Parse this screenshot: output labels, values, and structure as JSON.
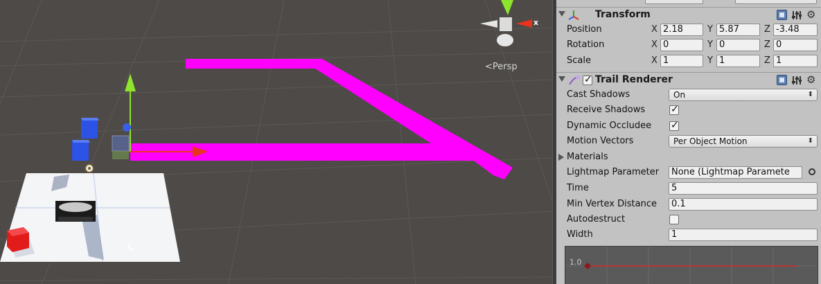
{
  "scene": {
    "persp_label": "Persp",
    "gizmo_axis_label": "x"
  },
  "transform": {
    "title": "Transform",
    "rows": [
      {
        "label": "Position",
        "x": "2.18",
        "y": "5.87",
        "z": "-3.48"
      },
      {
        "label": "Rotation",
        "x": "0",
        "y": "0",
        "z": "0"
      },
      {
        "label": "Scale",
        "x": "1",
        "y": "1",
        "z": "1"
      }
    ],
    "axis_x": "X",
    "axis_y": "Y",
    "axis_z": "Z"
  },
  "trail_renderer": {
    "title": "Trail Renderer",
    "enabled": true,
    "cast_shadows_label": "Cast Shadows",
    "cast_shadows_value": "On",
    "receive_shadows_label": "Receive Shadows",
    "receive_shadows_checked": true,
    "dynamic_occludee_label": "Dynamic Occludee",
    "dynamic_occludee_checked": true,
    "motion_vectors_label": "Motion Vectors",
    "motion_vectors_value": "Per Object Motion",
    "materials_label": "Materials",
    "lightmap_label": "Lightmap Parameter",
    "lightmap_value": "None (Lightmap Paramete",
    "time_label": "Time",
    "time_value": "5",
    "min_vertex_label": "Min Vertex Distance",
    "min_vertex_value": "0.1",
    "autodestruct_label": "Autodestruct",
    "autodestruct_checked": false,
    "width_label": "Width",
    "width_value": "1",
    "curve_y_label": "1.0"
  },
  "colors": {
    "trail": "#ff00ff",
    "inspector_bg": "#c2c2c2",
    "scene_bg": "#4d4a47",
    "axis_x": "#e8341c",
    "axis_y": "#8ee52d",
    "axis_z": "#3a5ee8"
  },
  "icons": {
    "transform": "transform-axes-icon",
    "trail_renderer": "trail-renderer-icon",
    "help": "help-book-icon",
    "preset": "preset-settings-icon",
    "gear": "gear-icon"
  }
}
